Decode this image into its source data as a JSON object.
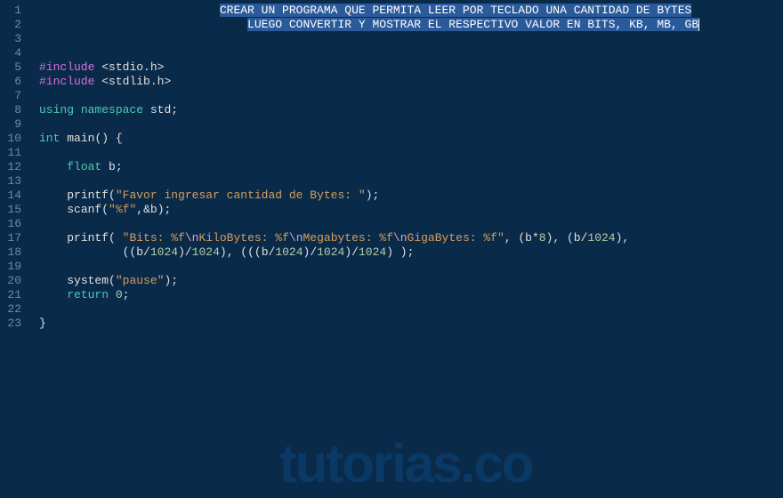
{
  "watermark": "tutorias.co",
  "lineNumbers": [
    "1",
    "2",
    "3",
    "4",
    "5",
    "6",
    "7",
    "8",
    "9",
    "10",
    "11",
    "12",
    "13",
    "14",
    "15",
    "16",
    "17",
    "18",
    "19",
    "20",
    "21",
    "22",
    "23"
  ],
  "code": {
    "line1_selected": "CREAR UN PROGRAMA QUE PERMITA LEER POR TECLADO UNA CANTIDAD DE BYTES",
    "line2_selected": "LUEGO CONVERTIR Y MOSTRAR EL RESPECTIVO VALOR EN BITS, KB, MB, GB",
    "line5_preproc": "#include",
    "line5_header": "<stdio.h>",
    "line6_preproc": "#include",
    "line6_header": "<stdlib.h>",
    "line8_using": "using",
    "line8_namespace": "namespace",
    "line8_std": "std",
    "line10_int": "int",
    "line10_main": "main",
    "line12_float": "float",
    "line12_var": "b",
    "line14_printf": "printf",
    "line14_string": "\"Favor ingresar cantidad de Bytes: \"",
    "line15_scanf": "scanf",
    "line15_fmt": "\"%f\"",
    "line15_arg": "&b",
    "line17_printf": "printf",
    "line17_s0": "\"Bits: %f",
    "line17_e1": "\\n",
    "line17_s1": "KiloBytes: %f",
    "line17_e2": "\\n",
    "line17_s2": "Megabytes: %f",
    "line17_e3": "\\n",
    "line17_s3": "GigaBytes: %f\"",
    "line17_a1": "(b*",
    "line17_n8": "8",
    "line17_a2": "), (b/",
    "line17_n1024a": "1024",
    "line17_a3": "),",
    "line18_a1": "((b/",
    "line18_n1": "1024",
    "line18_a2": ")/",
    "line18_n2": "1024",
    "line18_a3": "), (((b/",
    "line18_n3": "1024",
    "line18_a4": ")/",
    "line18_n4": "1024",
    "line18_a5": ")/",
    "line18_n5": "1024",
    "line18_a6": ") );",
    "line20_system": "system",
    "line20_string": "\"pause\"",
    "line21_return": "return",
    "line21_zero": "0"
  }
}
